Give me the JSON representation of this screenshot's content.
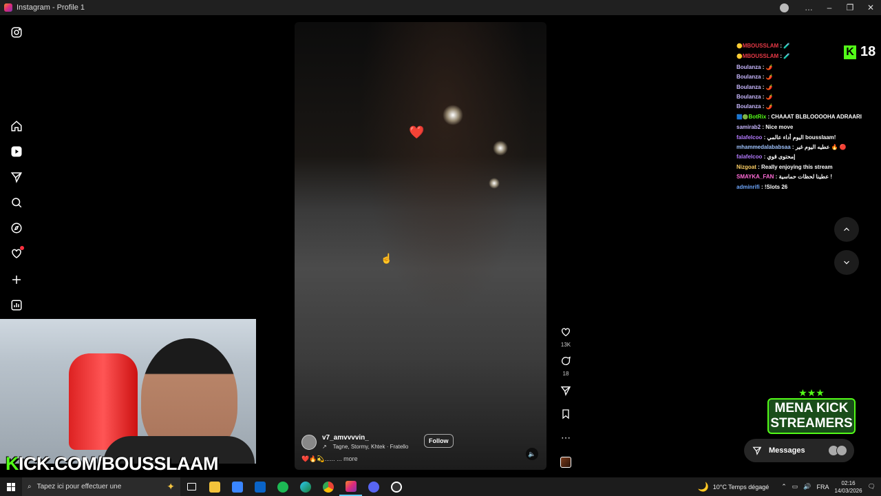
{
  "window": {
    "title": "Instagram - Profile 1",
    "controls": [
      "…",
      "–",
      "❐",
      "✕"
    ]
  },
  "nav": [
    "instagram-logo",
    "home",
    "reels",
    "messages",
    "search",
    "explore",
    "notifications",
    "create",
    "dashboard"
  ],
  "reel": {
    "username": "v7_amvvvvin_",
    "music": "Tagne, Stormy, Khtek · Fratello",
    "follow_label": "Follow",
    "description": "❤️🔥💫...... ... more",
    "likes": "13K",
    "comments": "18"
  },
  "chat": [
    {
      "user": "MBOUSSLAM",
      "msg": "🧪",
      "color": "#e63946",
      "badge": "🟡"
    },
    {
      "user": "MBOUSSLAM",
      "msg": "🧪",
      "color": "#e63946",
      "badge": "🟡"
    },
    {
      "user": "Boulanza",
      "msg": "🌶️",
      "color": "#c9b8ff",
      "badge": ""
    },
    {
      "user": "Boulanza",
      "msg": "🌶️",
      "color": "#c9b8ff",
      "badge": ""
    },
    {
      "user": "Boulanza",
      "msg": "🌶️",
      "color": "#c9b8ff",
      "badge": ""
    },
    {
      "user": "Boulanza",
      "msg": "🌶️",
      "color": "#c9b8ff",
      "badge": ""
    },
    {
      "user": "Boulanza",
      "msg": "🌶️",
      "color": "#c9b8ff",
      "badge": ""
    },
    {
      "user": "BotRix",
      "msg": "CHAAAT BLBLOOOOHA ADRAARI",
      "color": "#53fc18",
      "badge": "🟦🟢"
    },
    {
      "user": "samirab2",
      "msg": "Nice move",
      "color": "#c9b8ff",
      "badge": ""
    },
    {
      "user": "falafelcoo",
      "msg": "اليوم أداء عالمي bousslaam!",
      "color": "#b57bff",
      "badge": ""
    },
    {
      "user": "mhammedalababsaa",
      "msg": "عطيه اليوم غير 🔥 🔴",
      "color": "#a0c4ff",
      "badge": ""
    },
    {
      "user": "falafelcoo",
      "msg": "إمحتوى قوي",
      "color": "#b57bff",
      "badge": ""
    },
    {
      "user": "Nizgoat",
      "msg": "Really enjoying this stream",
      "color": "#ffd166",
      "badge": ""
    },
    {
      "user": "SMAYKA_FAN",
      "msg": "عطينا لحظات حماسية !",
      "color": "#ff6bd6",
      "badge": ""
    },
    {
      "user": "adminrifi",
      "msg": "!Slots 26",
      "color": "#6fa8ff",
      "badge": ""
    }
  ],
  "kick": {
    "viewer_count": "18",
    "letter": "K"
  },
  "webcam_banner": {
    "k": "K",
    "rest": "ICK.COM/BOUSSLAAM"
  },
  "mena_logo": {
    "stars": "★★★",
    "line1": "MENA KICK",
    "line2": "STREAMERS"
  },
  "messages_label": "Messages",
  "taskbar": {
    "search_placeholder": "Tapez ici pour effectuer une",
    "weather": "10°C  Temps dégagé",
    "lang": "FRA",
    "time": "02:16",
    "date": "14/03/2026"
  }
}
